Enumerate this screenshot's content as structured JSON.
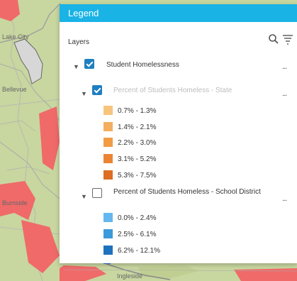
{
  "map": {
    "place_labels": [
      "Lake City",
      "Bellevue",
      "Burnside",
      "Ingleside"
    ]
  },
  "legend": {
    "title": "Legend",
    "layers_label": "Layers",
    "root_layer": {
      "name": "Student Homelessness",
      "checked": true,
      "sublayers": [
        {
          "name": "Percent of Students Homeless - State",
          "checked": true,
          "classes": [
            {
              "label": "0.7% - 1.3%",
              "color": "#f7c47e"
            },
            {
              "label": "1.4% - 2.1%",
              "color": "#f4ae5f"
            },
            {
              "label": "2.2% - 3.0%",
              "color": "#f29b45"
            },
            {
              "label": "3.1% - 5.2%",
              "color": "#ec8533"
            },
            {
              "label": "5.3% - 7.5%",
              "color": "#dd6d22"
            }
          ]
        },
        {
          "name": "Percent of Students Homeless - School District",
          "checked": false,
          "classes": [
            {
              "label": "0.0% - 2.4%",
              "color": "#64b8ef"
            },
            {
              "label": "2.5% - 6.1%",
              "color": "#3a9adb"
            },
            {
              "label": "6.2% - 12.1%",
              "color": "#1e72bd"
            }
          ]
        }
      ]
    },
    "more_label": "..."
  }
}
